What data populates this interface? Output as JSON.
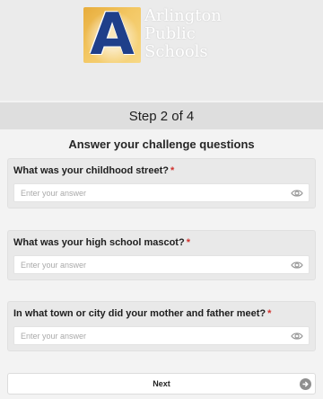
{
  "logo": {
    "letter": "A",
    "line1": "Arlington",
    "line2": "Public",
    "line3": "Schools"
  },
  "step": {
    "label": "Step 2 of 4"
  },
  "form": {
    "title": "Answer your challenge questions",
    "required_marker": "*",
    "questions": [
      {
        "label": "What was your childhood street?",
        "placeholder": "Enter your answer"
      },
      {
        "label": "What was your high school mascot?",
        "placeholder": "Enter your answer"
      },
      {
        "label": "In what town or city did your mother and father meet?",
        "placeholder": "Enter your answer"
      }
    ],
    "icons": {
      "reveal": "eye-icon",
      "next": "arrow-right-circle-icon"
    }
  },
  "actions": {
    "next_label": "Next"
  },
  "colors": {
    "logo_blue": "#1f3f8a",
    "logo_gold": "#f3c763",
    "required_red": "#d0312d",
    "step_bar": "#dedede"
  }
}
